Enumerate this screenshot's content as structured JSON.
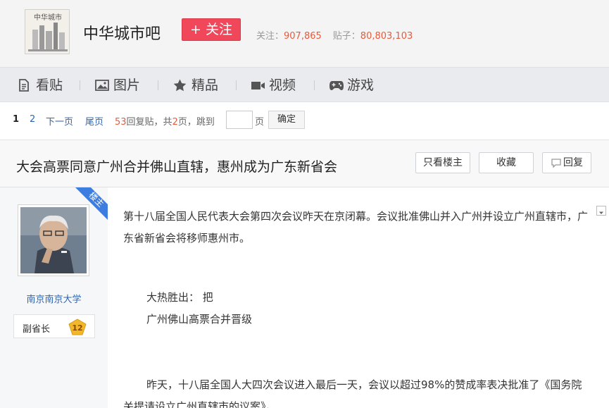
{
  "header": {
    "forum_name": "中华城市吧",
    "follow_label": "+ 关注",
    "followers_label": "关注：",
    "followers_value": "907,865",
    "posts_label": "贴子：",
    "posts_value": "80,803,103",
    "logo_text": "中华城市"
  },
  "nav": {
    "items": [
      {
        "label": "看贴",
        "icon": "document-icon"
      },
      {
        "label": "图片",
        "icon": "image-icon"
      },
      {
        "label": "精品",
        "icon": "star-icon"
      },
      {
        "label": "视频",
        "icon": "video-icon"
      },
      {
        "label": "游戏",
        "icon": "gamepad-icon"
      }
    ]
  },
  "pager": {
    "current": "1",
    "page2": "2",
    "next": "下一页",
    "last": "尾页",
    "reply_count": "53",
    "reply_label": "回复贴，共",
    "page_total": "2",
    "page_label": "页，跳到",
    "page_suffix": "页",
    "confirm": "确定"
  },
  "thread": {
    "title": "大会高票同意广州合并佛山直辖，惠州成为广东新省会",
    "only_op": "只看楼主",
    "favorite": "收藏",
    "reply": "回复"
  },
  "post": {
    "badge": "楼主",
    "author": "南京南京大学",
    "level_title": "副省长",
    "level": "12",
    "lines": [
      "第十八届全国人民代表大会第四次会议昨天在京闭幕。会议批准佛山并入广州并设立广州直辖市，广东省新省会将移师惠州市。",
      "大热胜出： 把",
      "广州佛山高票合并晋级",
      "昨天，十八届全国人大四次会议进入最后一天，会议以超过98%的赞成率表决批准了《国务院关提请设立广州直辖市的议案》。"
    ]
  },
  "colors": {
    "follow": "#f0485a",
    "link": "#2d64b3",
    "accent_num": "#e85a3c",
    "badge": "#3e7de0",
    "level_badge": "#f0b82a"
  }
}
